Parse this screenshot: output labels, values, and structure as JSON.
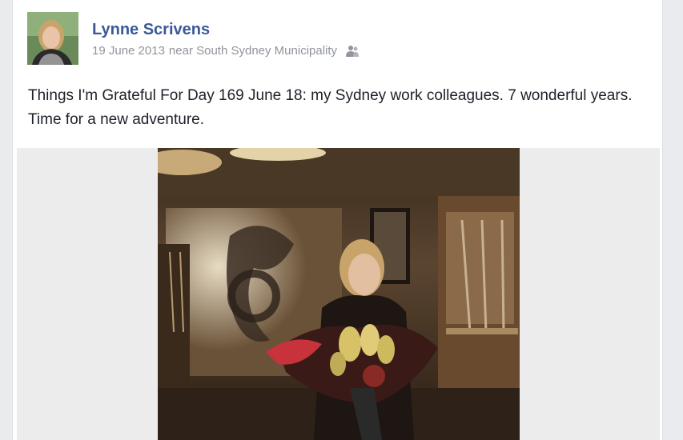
{
  "post": {
    "author": "Lynne Scrivens",
    "date": "19 June 2013",
    "location": "near South Sydney Municipality",
    "audience_icon": "friends-icon",
    "text": "Things I'm Grateful For Day 169 June 18: my Sydney work colleagues. 7 wonderful years. Time for a new adventure."
  },
  "colors": {
    "name": "#3b5998",
    "meta": "#90949c",
    "text": "#1d2129",
    "photo_bg": "#ececec"
  }
}
